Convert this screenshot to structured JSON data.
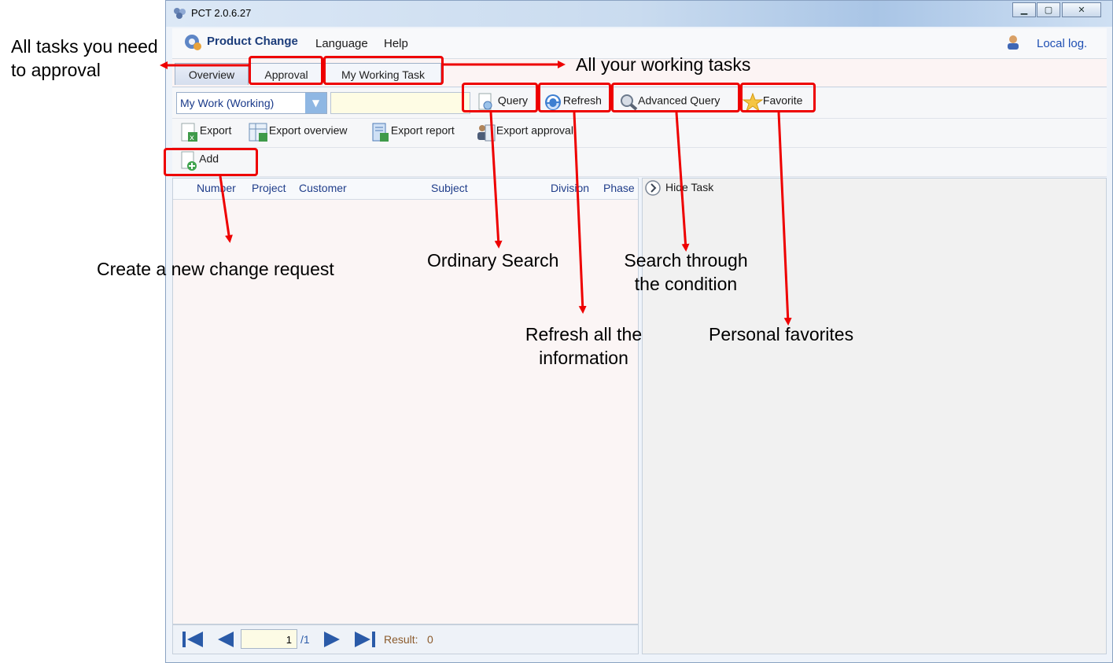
{
  "window": {
    "title": "PCT 2.0.6.27"
  },
  "menu": {
    "product_change": "Product Change",
    "language": "Language",
    "help": "Help",
    "local_log": "Local log."
  },
  "tabs": [
    {
      "label": "Overview"
    },
    {
      "label": "Approval"
    },
    {
      "label": "My Working Task"
    }
  ],
  "filter": {
    "selected": "My Work (Working)",
    "search_value": ""
  },
  "toolbar": {
    "query": "Query",
    "refresh": "Refresh",
    "advanced_query": "Advanced Query",
    "favorite": "Favorite",
    "export": "Export",
    "export_overview": "Export overview",
    "export_report": "Export report",
    "export_approval": "Export approval",
    "add": "Add"
  },
  "grid": {
    "columns": [
      "Number",
      "Project",
      "Customer",
      "Subject",
      "Division",
      "Phase"
    ]
  },
  "side_panel": {
    "hide_task": "Hide Task"
  },
  "pager": {
    "current_page": "1",
    "total": "/1",
    "result_label": "Result:",
    "result_count": "0"
  },
  "annotations": {
    "approval_tasks": "All tasks you need to approval",
    "working_tasks": "All your working tasks",
    "create_request": "Create a new change request",
    "ordinary_search": "Ordinary Search",
    "refresh_info": "Refresh all the information",
    "search_condition": "Search through the condition",
    "favorites": "Personal favorites"
  },
  "colors": {
    "annotation_red": "#ee0000",
    "header_text": "#1f3d8a",
    "result_text": "#8b5a2b"
  }
}
